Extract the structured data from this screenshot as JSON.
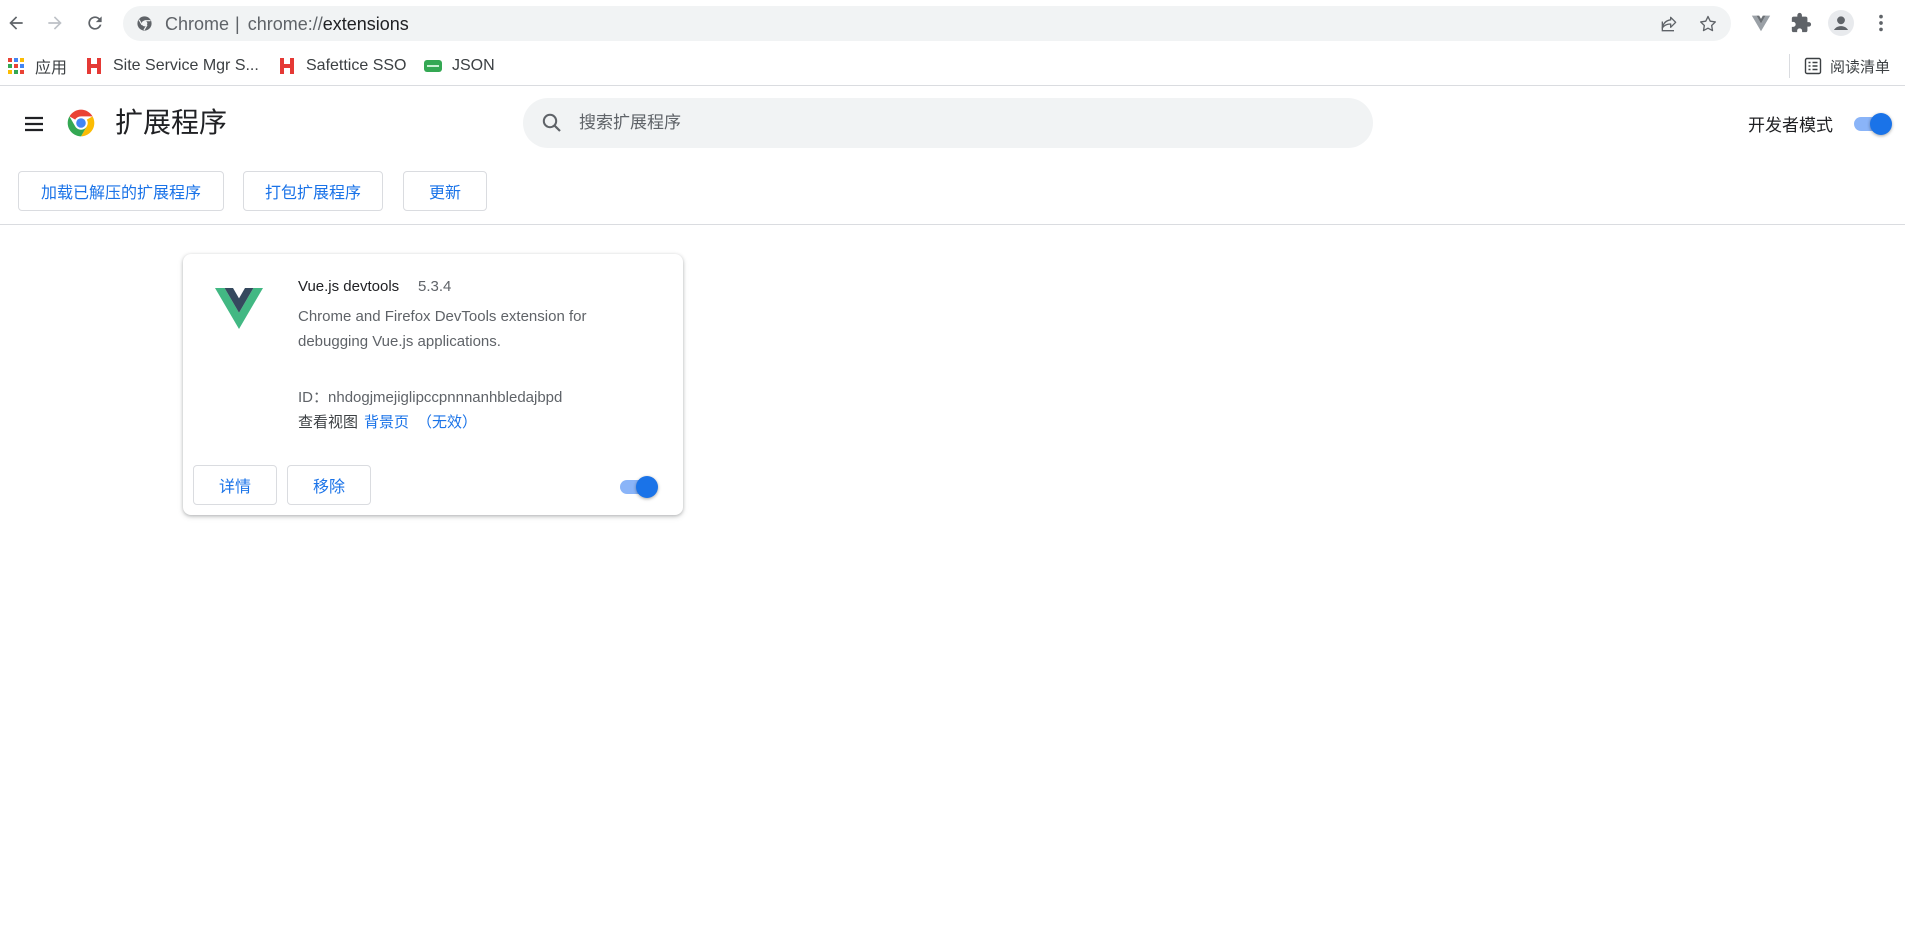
{
  "browser": {
    "omnibox": {
      "scheme_label": "Chrome",
      "separator": "|",
      "url_prefix": "chrome://",
      "url_path": "extensions"
    },
    "bookmarks": [
      {
        "label": "应用",
        "icon": "apps-grid-icon"
      },
      {
        "label": "Site Service Mgr S...",
        "icon": "h-brand-icon"
      },
      {
        "label": "Safettice SSO",
        "icon": "h-brand-icon"
      },
      {
        "label": "JSON",
        "icon": "json-icon"
      }
    ],
    "reading_list": "阅读清单"
  },
  "extensions_page": {
    "title": "扩展程序",
    "search_placeholder": "搜索扩展程序",
    "dev_mode_label": "开发者模式",
    "dev_mode_enabled": true,
    "actions": {
      "load_unpacked": "加载已解压的扩展程序",
      "pack": "打包扩展程序",
      "update": "更新"
    },
    "extensions": [
      {
        "name": "Vue.js devtools",
        "version": "5.3.4",
        "description": "Chrome and Firefox DevTools extension for debugging Vue.js applications.",
        "id_label": "ID：",
        "id": "nhdogjmejiglipccpnnnanhbledajbpd",
        "views_label": "查看视图",
        "view_link": "背景页",
        "view_status": "（无效）",
        "details_label": "详情",
        "remove_label": "移除",
        "enabled": true
      }
    ]
  },
  "colors": {
    "accent": "#1a73e8",
    "toggle_track": "#8ab4f8",
    "vue_green": "#42b883",
    "vue_dark": "#35495e"
  }
}
